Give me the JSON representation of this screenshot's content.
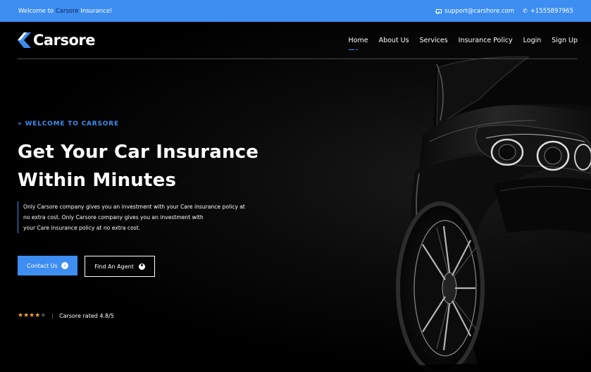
{
  "topbar": {
    "welcome_prefix": "Welcome to ",
    "welcome_brand": "Carsore",
    "welcome_suffix": " Insurance!",
    "email": "support@carshore.com",
    "phone": "+1555897965"
  },
  "nav": {
    "logo": "Carsore",
    "items": [
      {
        "label": "Home",
        "active": true
      },
      {
        "label": "About Us"
      },
      {
        "label": "Services"
      },
      {
        "label": "Insurance Policy"
      },
      {
        "label": "Login"
      },
      {
        "label": "Sign Up"
      }
    ]
  },
  "hero": {
    "eyebrow": "WELCOME TO CARSORE",
    "headline_line1": "Get Your Car Insurance",
    "headline_line2": "Within Minutes",
    "desc_line1": "Only Carsore company gives you an investment with your Care insurance policy at",
    "desc_line2": "no extra cost. Only Carsore company gives you an investment with",
    "desc_line3": "your Care insurance policy at no extra cost.",
    "cta_primary": "Contact Us",
    "cta_secondary": "Find An Agent",
    "rating_text": "Carsore rated 4.8/5",
    "rating_value": 4.8,
    "rating_max": 5
  },
  "colors": {
    "accent": "#3d8ef0",
    "brand_dark": "#13225a",
    "star": "#f5a623"
  },
  "icons": [
    "mail-icon",
    "phone-icon",
    "logo-mark-icon",
    "arrow-right-icon",
    "user-icon",
    "star-icon"
  ]
}
